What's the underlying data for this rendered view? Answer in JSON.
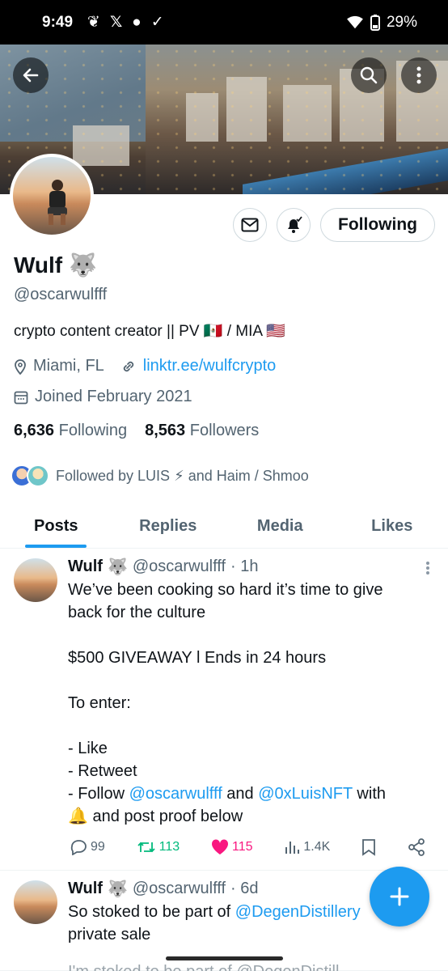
{
  "status_bar": {
    "time": "9:49",
    "battery": "29%"
  },
  "profile": {
    "name": "Wulf",
    "name_emoji": "🐺",
    "handle": "@oscarwulfff",
    "bio": "crypto content creator || PV 🇲🇽 / MIA 🇺🇸",
    "location": "Miami, FL",
    "link": "linktr.ee/wulfcrypto",
    "joined": "Joined February 2021",
    "following_count": "6,636",
    "following_label": "Following",
    "followers_count": "8,563",
    "followers_label": "Followers",
    "followed_by": "Followed by LUIS ⚡ and Haim / Shmoo",
    "follow_button": "Following"
  },
  "tabs": [
    {
      "label": "Posts",
      "active": true
    },
    {
      "label": "Replies",
      "active": false
    },
    {
      "label": "Media",
      "active": false
    },
    {
      "label": "Likes",
      "active": false
    }
  ],
  "posts": [
    {
      "name": "Wulf",
      "emoji": "🐺",
      "handle": "@oscarwulfff",
      "time": "· 1h",
      "line1": "We’ve been cooking so hard it’s time to give",
      "line2": "back for the culture",
      "line3": "$500 GIVEAWAY l Ends in 24 hours",
      "line4": "To enter:",
      "line5": "- Like",
      "line6": "- Retweet",
      "line7_pre": "- Follow ",
      "mention1": "@oscarwulfff",
      "line7_mid": " and ",
      "mention2": "@0xLuisNFT",
      "line7_post": " with",
      "line8": "🔔 and post proof below",
      "replies": "99",
      "retweets": "113",
      "likes": "115",
      "views": "1.4K"
    },
    {
      "name": "Wulf",
      "emoji": "🐺",
      "handle": "@oscarwulfff",
      "time": "· 6d",
      "line1_pre": "So stoked to be part of ",
      "mention1": "@DegenDistillery",
      "line2": "private sale"
    }
  ],
  "peek_text": "I'm stoked to be part of @DegenDistill",
  "colors": {
    "accent": "#1d9bf0",
    "retweet": "#00ba7c",
    "like": "#f91880",
    "secondary_text": "#536471"
  },
  "icons": [
    "back-arrow-icon",
    "search-icon",
    "more-vertical-icon",
    "mail-icon",
    "bell-icon",
    "location-icon",
    "link-icon",
    "calendar-icon",
    "reply-icon",
    "retweet-icon",
    "heart-icon",
    "views-icon",
    "bookmark-icon",
    "share-icon",
    "plus-icon"
  ]
}
